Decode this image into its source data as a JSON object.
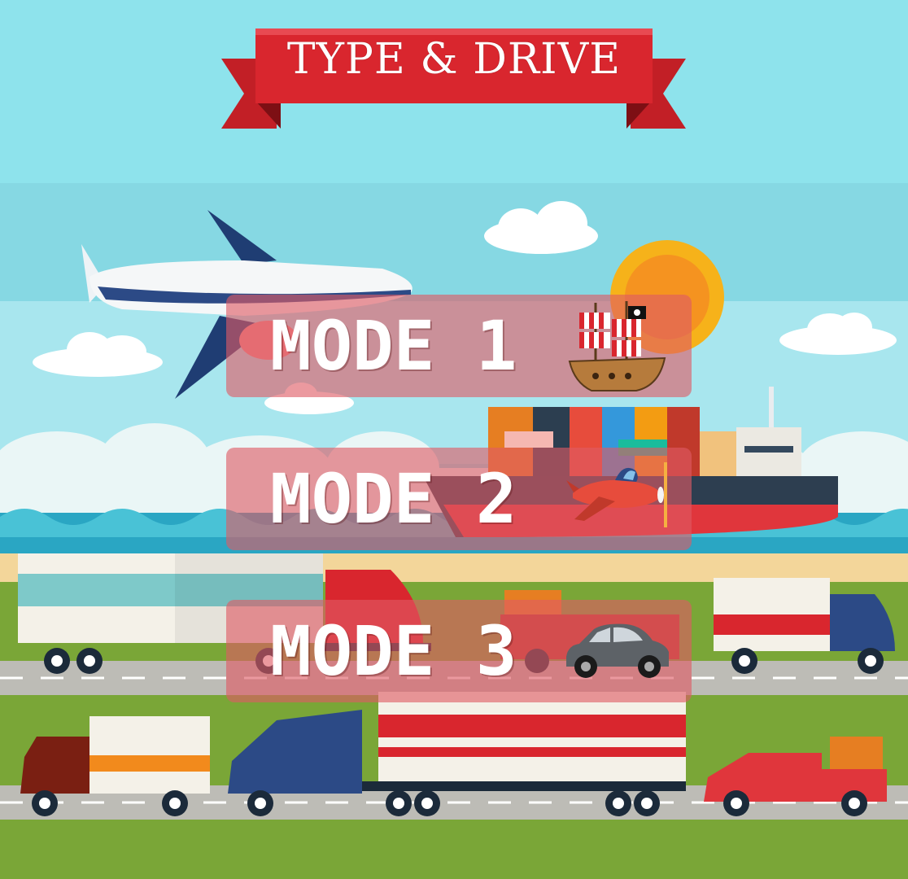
{
  "title": "TYPE & DRIVE",
  "menu": {
    "modes": [
      {
        "label": "MODE 1",
        "icon": "pirate-ship-icon"
      },
      {
        "label": "MODE 2",
        "icon": "airplane-icon"
      },
      {
        "label": "MODE 3",
        "icon": "car-icon"
      }
    ]
  },
  "colors": {
    "sky": "#8ee0ea",
    "banner": "#d9262e",
    "grass": "#7aa637",
    "road": "#bdbcb6",
    "sea": "#2aa6c3",
    "button": "#de5a64"
  }
}
